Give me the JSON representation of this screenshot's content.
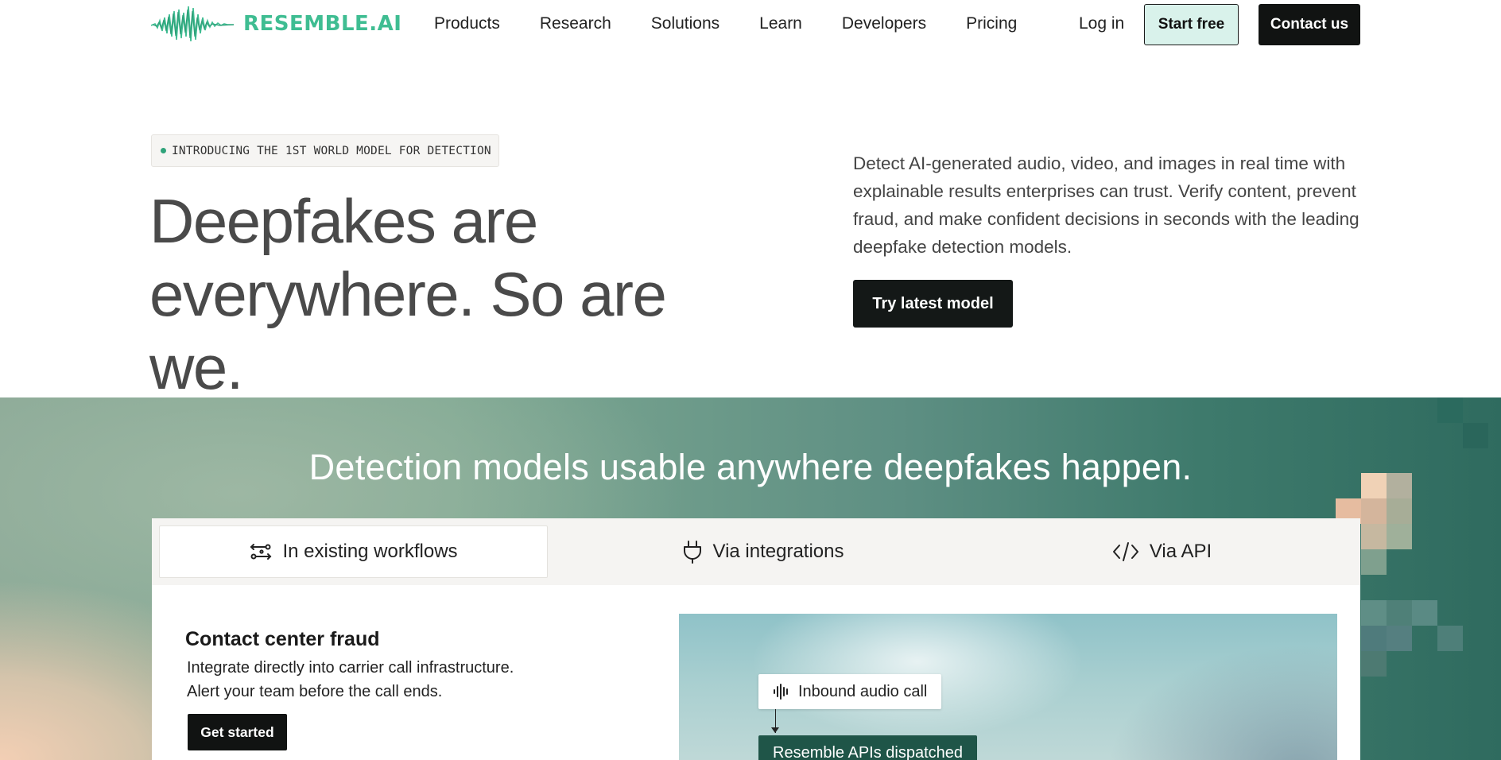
{
  "header": {
    "logo_text": "RESEMBLE.AI",
    "nav": [
      "Products",
      "Research",
      "Solutions",
      "Learn",
      "Developers",
      "Pricing"
    ],
    "login_label": "Log in",
    "start_free_label": "Start free",
    "contact_label": "Contact us"
  },
  "hero": {
    "badge": "INTRODUCING THE 1ST WORLD MODEL FOR DETECTION",
    "title_line1": "Deepfakes are",
    "title_line2": "everywhere. So are we.",
    "description": "Detect AI-generated audio, video, and images in real time with explainable results enterprises can trust. Verify content, prevent fraud, and make confident decisions in seconds with the leading deepfake detection models.",
    "cta_label": "Try latest model"
  },
  "section": {
    "title": "Detection models usable anywhere deepfakes happen.",
    "tabs": [
      {
        "label": "In existing workflows",
        "icon": "workflow-icon",
        "active": true
      },
      {
        "label": "Via integrations",
        "icon": "plug-icon",
        "active": false
      },
      {
        "label": "Via API",
        "icon": "code-icon",
        "active": false
      }
    ],
    "card": {
      "title": "Contact center fraud",
      "line1": "Integrate directly into carrier call infrastructure.",
      "line2": "Alert your team before the call ends.",
      "cta_label": "Get started"
    },
    "illustration": {
      "step1": "Inbound audio call",
      "step2": "Resemble APIs dispatched"
    }
  },
  "colors": {
    "brand": "#3fbd92",
    "dark": "#111312",
    "start_free_bg": "#d9f2eb",
    "dispatched_bg": "#1f5548"
  }
}
